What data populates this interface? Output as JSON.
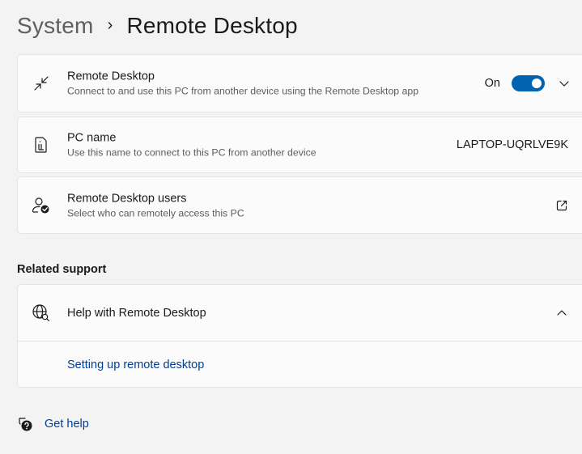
{
  "breadcrumb": {
    "parent": "System",
    "separator": "›",
    "current": "Remote Desktop"
  },
  "remote_desktop": {
    "title": "Remote Desktop",
    "subtitle": "Connect to and use this PC from another device using the Remote Desktop app",
    "toggle_label": "On",
    "toggle_state": true,
    "icon": "remote-desktop-icon",
    "accent_color": "#0063b1"
  },
  "pc_name": {
    "title": "PC name",
    "subtitle": "Use this name to connect to this PC from another device",
    "value": "LAPTOP-UQRLVE9K",
    "icon": "pc-info-icon"
  },
  "remote_users": {
    "title": "Remote Desktop users",
    "subtitle": "Select who can remotely access this PC",
    "icon": "user-check-icon",
    "action_icon": "open-external-icon"
  },
  "related_support": {
    "heading": "Related support",
    "help_title": "Help with Remote Desktop",
    "help_icon": "globe-search-icon",
    "expanded": true,
    "links": [
      "Setting up remote desktop"
    ],
    "link_color": "#003e92"
  },
  "get_help": {
    "label": "Get help",
    "icon": "help-chat-icon"
  }
}
